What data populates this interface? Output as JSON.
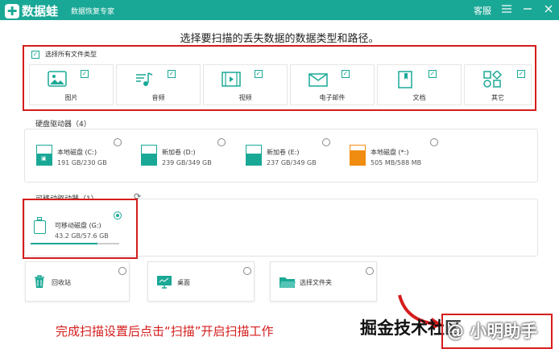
{
  "titlebar": {
    "app_name": "数据蛙",
    "subtitle": "数据恢复专家",
    "service": "客服",
    "menu_icon": "hamburger-icon",
    "min_icon": "minimize-icon",
    "close_icon": "close-icon"
  },
  "heading": "选择要扫描的丢失数据的数据类型和路径。",
  "file_types": {
    "select_all_label": "选择所有文件类型",
    "items": [
      {
        "label": "图片",
        "icon": "picture-icon",
        "checked": true
      },
      {
        "label": "音频",
        "icon": "audio-icon",
        "checked": true
      },
      {
        "label": "视频",
        "icon": "video-icon",
        "checked": true
      },
      {
        "label": "电子邮件",
        "icon": "email-icon",
        "checked": true
      },
      {
        "label": "文档",
        "icon": "document-icon",
        "checked": true
      },
      {
        "label": "其它",
        "icon": "other-icon",
        "checked": true
      }
    ]
  },
  "hard_drives": {
    "title": "硬盘驱动器（4）",
    "items": [
      {
        "name": "本地磁盘 (C:)",
        "size": "191 GB/230 GB",
        "used": 0.83,
        "color": "#1aa896",
        "selected": false
      },
      {
        "name": "新加卷 (D:)",
        "size": "239 GB/349 GB",
        "used": 0.68,
        "color": "#1aa896",
        "selected": false
      },
      {
        "name": "新加卷 (E:)",
        "size": "237 GB/349 GB",
        "used": 0.68,
        "color": "#1aa896",
        "selected": false
      },
      {
        "name": "本地磁盘 (*:)",
        "size": "505 MB/588 MB",
        "used": 0.86,
        "color": "#f08c0f",
        "selected": false
      }
    ]
  },
  "removable": {
    "title": "可移动驱动器（1）",
    "refresh_icon": "refresh-icon",
    "items": [
      {
        "name": "可移动磁盘 (G:)",
        "size": "43.2 GB/57.6 GB",
        "used": 0.75,
        "selected": true
      }
    ]
  },
  "locations": [
    {
      "label": "回收站",
      "icon": "recycle-bin-icon",
      "selected": false
    },
    {
      "label": "桌面",
      "icon": "desktop-icon",
      "selected": false
    },
    {
      "label": "选择文件夹",
      "icon": "folder-icon",
      "selected": false
    }
  ],
  "caption": "完成扫描设置后点击“扫描”开启扫描工作",
  "watermark": {
    "site": "掘金技术社区",
    "user": "@ 小明助手"
  },
  "colors": {
    "brand": "#1aa896",
    "annotation": "#d51c1c",
    "orange": "#f08c0f"
  }
}
